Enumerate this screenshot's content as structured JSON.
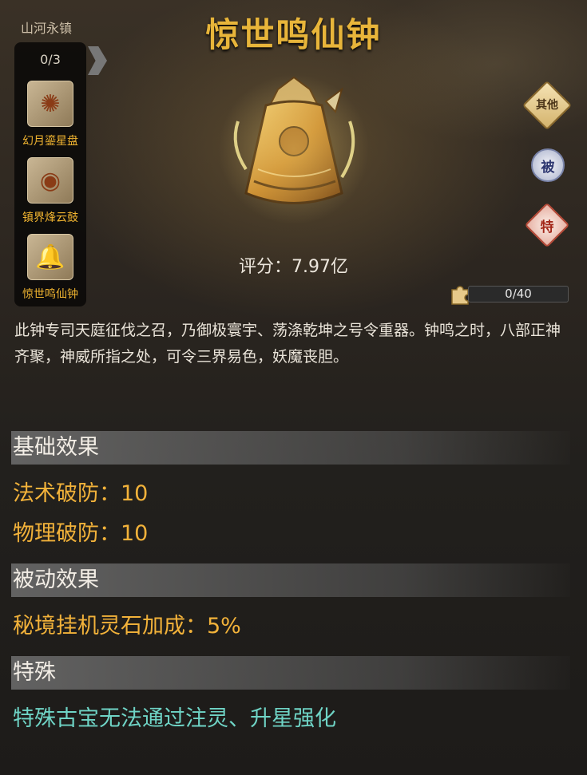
{
  "title": "惊世鸣仙钟",
  "series_name": "山河永镇",
  "side_panel": {
    "count": "0/3",
    "items": [
      {
        "label": "幻月鎏星盘",
        "icon": "fire-disk-icon"
      },
      {
        "label": "镇界烽云鼓",
        "icon": "drum-icon"
      },
      {
        "label": "惊世鸣仙钟",
        "icon": "bell-icon"
      }
    ]
  },
  "right_buttons": {
    "other": "其他",
    "passive": "被",
    "special": "特"
  },
  "score": "评分：7.97亿",
  "fragments": {
    "text": "0/40",
    "progress": 0
  },
  "description": "此钟专司天庭征伐之召，乃御极寰宇、荡涤乾坤之号令重器。钟鸣之时，八部正神齐聚，神威所指之处，可令三界易色，妖魔丧胆。",
  "sections": {
    "base": {
      "title": "基础效果",
      "stats": [
        "法术破防：10",
        "物理破防：10"
      ]
    },
    "passive": {
      "title": "被动效果",
      "stats": [
        "秘境挂机灵石加成：5%"
      ]
    },
    "special": {
      "title": "特殊",
      "text": "特殊古宝无法通过注灵、升星强化"
    }
  },
  "colors": {
    "gold": "#e8b53a",
    "stat": "#f2b23a",
    "special": "#6fd4c6"
  }
}
